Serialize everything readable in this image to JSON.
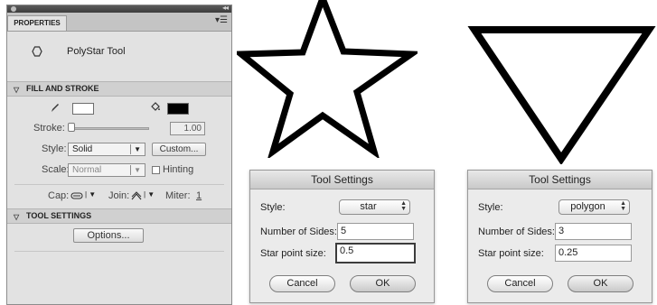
{
  "panel": {
    "tab_label": "PROPERTIES",
    "menu_icon": "panel-menu-icon",
    "tool_icon": "polygon-icon",
    "tool_name": "PolyStar Tool",
    "fill_stroke": {
      "header": "FILL AND STROKE",
      "stroke_color": "#ffffff",
      "fill_color": "#000000",
      "stroke_label": "Stroke:",
      "stroke_value": "1.00",
      "style_label": "Style:",
      "style_value": "Solid",
      "custom_label": "Custom...",
      "scale_label": "Scale:",
      "scale_value": "Normal",
      "hinting_label": "Hinting",
      "cap_label": "Cap:",
      "join_label": "Join:",
      "miter_label": "Miter:",
      "miter_value": "1"
    },
    "tool_settings": {
      "header": "TOOL SETTINGS",
      "options_label": "Options..."
    }
  },
  "dialog_star": {
    "title": "Tool Settings",
    "style_label": "Style:",
    "style_value": "star",
    "sides_label": "Number of Sides:",
    "sides_value": "5",
    "point_label": "Star point size:",
    "point_value": "0.5",
    "cancel_label": "Cancel",
    "ok_label": "OK"
  },
  "dialog_polygon": {
    "title": "Tool Settings",
    "style_label": "Style:",
    "style_value": "polygon",
    "sides_label": "Number of Sides:",
    "sides_value": "3",
    "point_label": "Star point size:",
    "point_value": "0.25",
    "cancel_label": "Cancel",
    "ok_label": "OK"
  }
}
